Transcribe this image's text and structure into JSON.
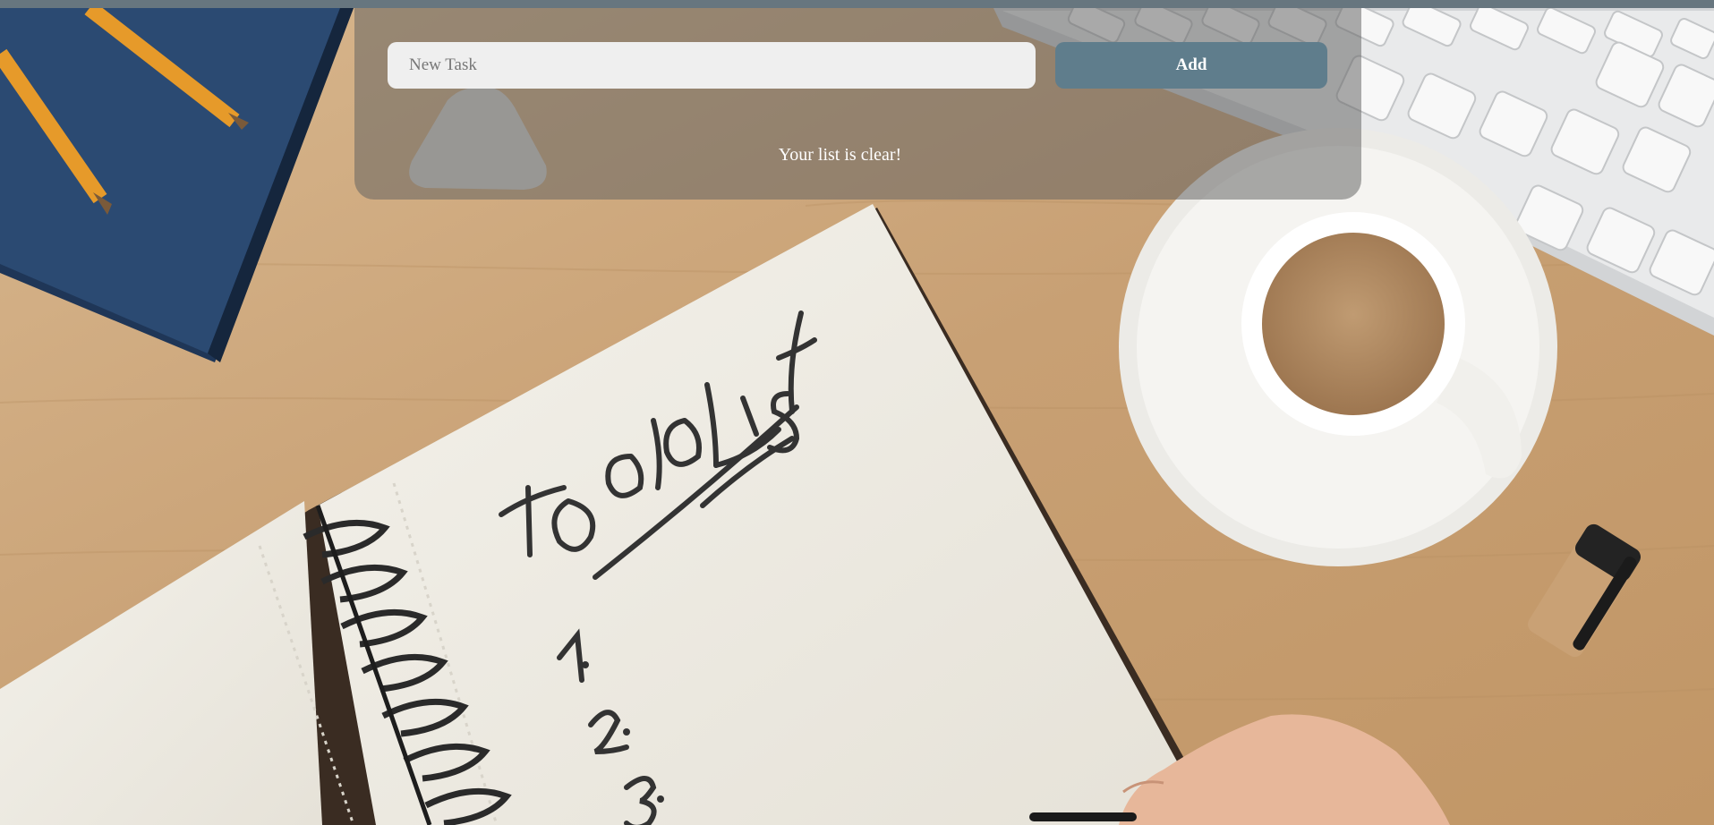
{
  "todo_app": {
    "input": {
      "placeholder": "New Task",
      "value": ""
    },
    "add_button": {
      "label": "Add"
    },
    "empty_message": "Your list is clear!"
  },
  "background": {
    "notebook_heading": "to do List",
    "notebook_items": [
      "1.",
      "2.",
      "3."
    ]
  },
  "colors": {
    "top_bar": "#67767f",
    "add_button": "#5f7d8c",
    "input_background": "#efefef",
    "panel_overlay": "rgba(95,95,95,0.52)",
    "desk": "#c9a57a"
  }
}
